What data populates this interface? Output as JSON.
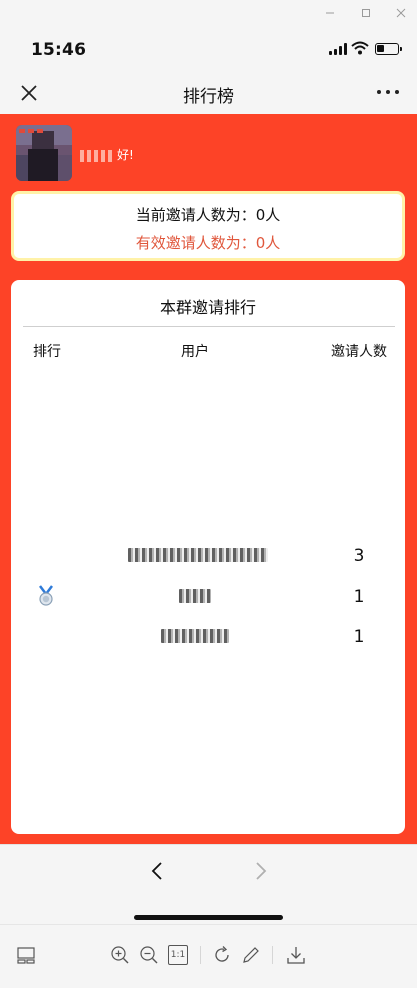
{
  "window": {
    "minimize_icon": "minimize-icon",
    "maximize_icon": "maximize-icon",
    "close_icon": "close-icon"
  },
  "status_bar": {
    "time": "15:46"
  },
  "nav_bar": {
    "title": "排行榜",
    "close_icon": "close-icon",
    "more_icon": "more-icon"
  },
  "header": {
    "greeting_suffix": "好!"
  },
  "invite_card": {
    "current_label": "当前邀请人数为：0人",
    "valid_label": "有效邀请人数为：0人",
    "valid_color": "#e0573c",
    "border_color": "#fff2a8"
  },
  "ranking": {
    "title": "本群邀请排行",
    "columns": [
      "排行",
      "用户",
      "邀请人数"
    ],
    "rows": [
      {
        "rank_icon": "",
        "count": "3"
      },
      {
        "rank_icon": "medal-icon",
        "count": "1"
      },
      {
        "rank_icon": "",
        "count": "1"
      }
    ]
  },
  "colors": {
    "background_red": "#fd4327",
    "card_white": "#ffffff"
  },
  "browser_nav": {
    "back_icon": "chevron-left-icon",
    "forward_icon": "chevron-right-icon"
  },
  "toolbar": {
    "zoom_ratio_label": "1:1",
    "icons": [
      "layout-icon",
      "zoom-in-icon",
      "zoom-out-icon",
      "actual-size-icon",
      "rotate-icon",
      "edit-icon",
      "download-icon"
    ]
  }
}
